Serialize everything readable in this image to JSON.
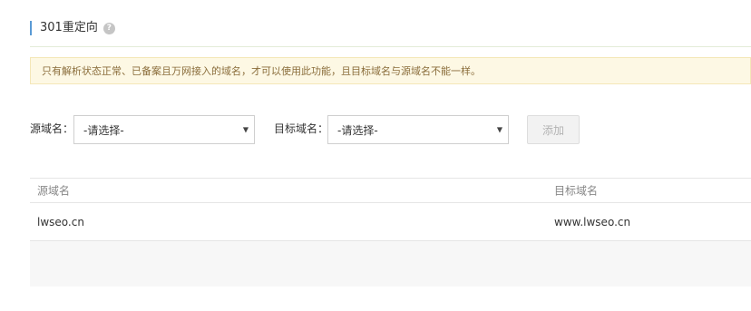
{
  "header": {
    "title": "301重定向",
    "help_icon": "?"
  },
  "notice": {
    "text": "只有解析状态正常、已备案且万网接入的域名，才可以使用此功能，且目标域名与源域名不能一样。"
  },
  "form": {
    "source_label": "源域名：",
    "source_value": "-请选择-",
    "target_label": "目标域名：",
    "target_value": "-请选择-",
    "add_button": "添加",
    "arrow": "▼"
  },
  "table": {
    "headers": [
      "源域名",
      "目标域名"
    ],
    "rows": [
      {
        "source": "lwseo.cn",
        "target": "www.lwseo.cn"
      }
    ]
  }
}
